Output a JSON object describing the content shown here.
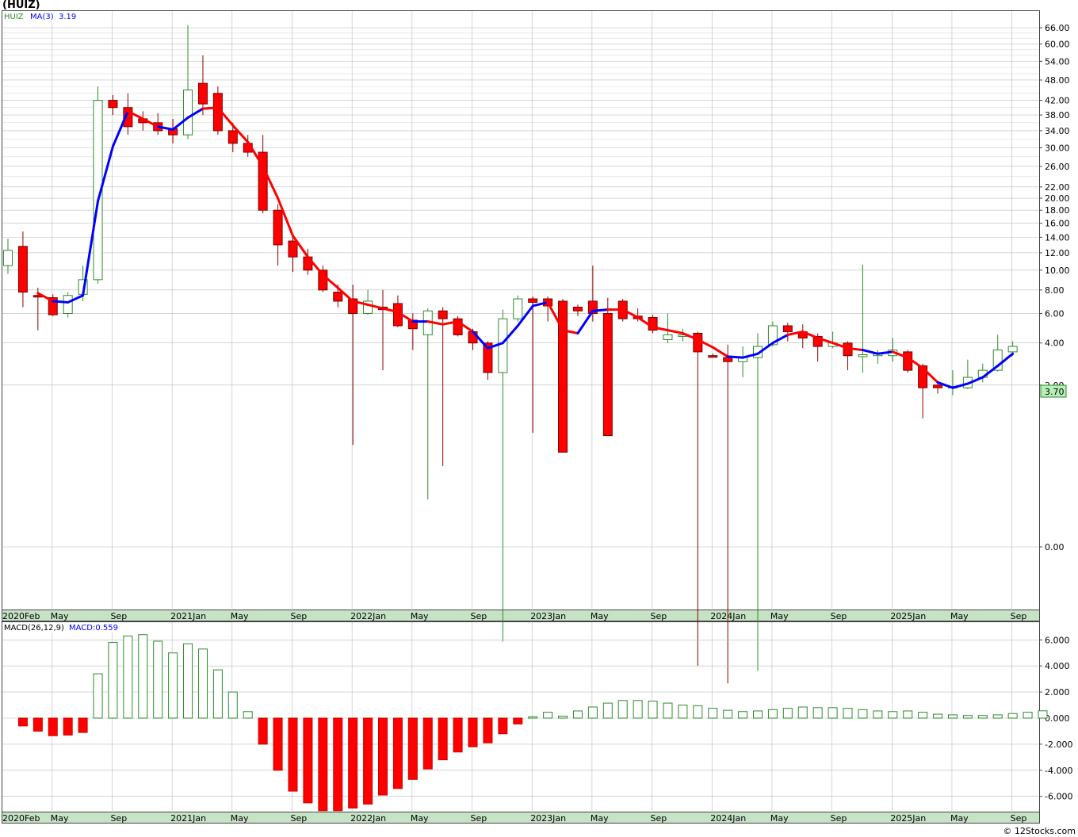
{
  "title": "(HUIZ)",
  "watermark": "© 12Stocks.com",
  "colors": {
    "up_candle": "#2e8b2e",
    "down_candle": "#ff0000",
    "ma_up": "#0000ff",
    "ma_down": "#ff0000",
    "grid": "#bbbbbb",
    "price_badge": "#b6f0b6"
  },
  "chart_data": [
    {
      "type": "candlestick",
      "title": "",
      "legend": {
        "symbol": "HUIZ",
        "ma_label": "MA(3)",
        "ma_value": "3.19"
      },
      "ylim": [
        -1.2,
        70
      ],
      "grid": true,
      "y_ticks": [
        "66.00",
        "60.00",
        "54.00",
        "48.00",
        "42.00",
        "38.00",
        "34.00",
        "30.00",
        "26.00",
        "22.00",
        "20.00",
        "18.00",
        "16.00",
        "14.00",
        "12.00",
        "10.00",
        "8.00",
        "6.00",
        "4.00",
        "2.00",
        "0.00"
      ],
      "x_tick_labels": [
        "2020Feb",
        "May",
        "Sep",
        "2021Jan",
        "May",
        "Sep",
        "2022Jan",
        "May",
        "Sep",
        "2023Jan",
        "May",
        "Sep",
        "2024Jan",
        "May",
        "Sep",
        "2025Jan",
        "May",
        "Sep"
      ],
      "last_price_label": "3.70",
      "candles": [
        {
          "o": 10.5,
          "h": 13.8,
          "l": 9.6,
          "c": 12.3
        },
        {
          "o": 12.8,
          "h": 14.8,
          "l": 6.5,
          "c": 7.8
        },
        {
          "o": 7.5,
          "h": 8.2,
          "l": 4.8,
          "c": 7.4
        },
        {
          "o": 7.3,
          "h": 7.6,
          "l": 5.8,
          "c": 5.9
        },
        {
          "o": 6.0,
          "h": 7.8,
          "l": 5.7,
          "c": 7.5
        },
        {
          "o": 7.6,
          "h": 10.5,
          "l": 7.0,
          "c": 9.0
        },
        {
          "o": 9.0,
          "h": 46.0,
          "l": 8.6,
          "c": 42.0
        },
        {
          "o": 42.0,
          "h": 43.5,
          "l": 38.0,
          "c": 40.0
        },
        {
          "o": 40.0,
          "h": 44.0,
          "l": 33.0,
          "c": 35.0
        },
        {
          "o": 37.0,
          "h": 39.0,
          "l": 34.0,
          "c": 36.0
        },
        {
          "o": 36.0,
          "h": 38.5,
          "l": 33.0,
          "c": 34.0
        },
        {
          "o": 34.5,
          "h": 37.0,
          "l": 31.0,
          "c": 33.0
        },
        {
          "o": 33.0,
          "h": 67.0,
          "l": 32.0,
          "c": 45.0
        },
        {
          "o": 47.0,
          "h": 56.0,
          "l": 38.0,
          "c": 41.0
        },
        {
          "o": 44.0,
          "h": 46.0,
          "l": 33.0,
          "c": 34.0
        },
        {
          "o": 34.0,
          "h": 36.0,
          "l": 29.0,
          "c": 31.0
        },
        {
          "o": 31.0,
          "h": 33.0,
          "l": 28.0,
          "c": 29.0
        },
        {
          "o": 29.0,
          "h": 33.0,
          "l": 17.5,
          "c": 18.0
        },
        {
          "o": 18.0,
          "h": 19.0,
          "l": 10.5,
          "c": 13.0
        },
        {
          "o": 13.5,
          "h": 14.5,
          "l": 9.8,
          "c": 11.5
        },
        {
          "o": 11.5,
          "h": 12.5,
          "l": 9.5,
          "c": 10.0
        },
        {
          "o": 10.0,
          "h": 10.5,
          "l": 7.8,
          "c": 8.0
        },
        {
          "o": 7.8,
          "h": 8.5,
          "l": 6.5,
          "c": 7.0
        },
        {
          "o": 7.2,
          "h": 8.5,
          "l": 0.5,
          "c": 6.0
        },
        {
          "o": 6.0,
          "h": 8.0,
          "l": 5.9,
          "c": 7.0
        },
        {
          "o": 6.5,
          "h": 8.0,
          "l": 2.6,
          "c": 6.3
        },
        {
          "o": 6.8,
          "h": 7.5,
          "l": 5.0,
          "c": 5.1
        },
        {
          "o": 5.5,
          "h": 6.0,
          "l": 3.6,
          "c": 4.9
        },
        {
          "o": 4.5,
          "h": 6.4,
          "l": 0.05,
          "c": 6.2
        },
        {
          "o": 6.2,
          "h": 6.5,
          "l": 0.25,
          "c": 5.6
        },
        {
          "o": 5.6,
          "h": 5.8,
          "l": 4.4,
          "c": 4.5
        },
        {
          "o": 4.7,
          "h": 4.9,
          "l": 3.6,
          "c": 4.0
        },
        {
          "o": 4.0,
          "h": 4.1,
          "l": 2.2,
          "c": 2.5
        },
        {
          "o": 2.5,
          "h": 6.3,
          "l": -0.4,
          "c": 5.6
        },
        {
          "o": 5.6,
          "h": 7.5,
          "l": 5.4,
          "c": 7.2
        },
        {
          "o": 7.2,
          "h": 7.4,
          "l": 0.7,
          "c": 6.9
        },
        {
          "o": 7.2,
          "h": 7.4,
          "l": 5.4,
          "c": 6.6
        },
        {
          "o": 7.0,
          "h": 7.2,
          "l": 0.4,
          "c": 0.4
        },
        {
          "o": 6.5,
          "h": 6.7,
          "l": 5.8,
          "c": 6.2
        },
        {
          "o": 7.0,
          "h": 10.5,
          "l": 5.4,
          "c": 6.0
        },
        {
          "o": 6.0,
          "h": 7.3,
          "l": 0.65,
          "c": 0.65
        },
        {
          "o": 7.0,
          "h": 7.2,
          "l": 5.4,
          "c": 5.6
        },
        {
          "o": 5.8,
          "h": 6.4,
          "l": 5.4,
          "c": 5.6
        },
        {
          "o": 5.7,
          "h": 5.9,
          "l": 4.6,
          "c": 4.8
        },
        {
          "o": 4.2,
          "h": 6.0,
          "l": 4.0,
          "c": 4.5
        },
        {
          "o": 4.5,
          "h": 4.9,
          "l": 4.1,
          "c": 4.5
        },
        {
          "o": 4.6,
          "h": 4.7,
          "l": -0.8,
          "c": 3.5
        },
        {
          "o": 3.3,
          "h": 3.4,
          "l": 3.2,
          "c": 3.25
        },
        {
          "o": 3.2,
          "h": 3.9,
          "l": -1.2,
          "c": 3.0
        },
        {
          "o": 3.0,
          "h": 3.8,
          "l": 2.3,
          "c": 3.2
        },
        {
          "o": 3.2,
          "h": 4.6,
          "l": -0.9,
          "c": 3.8
        },
        {
          "o": 3.9,
          "h": 5.4,
          "l": 3.8,
          "c": 5.1
        },
        {
          "o": 5.1,
          "h": 5.3,
          "l": 4.1,
          "c": 4.7
        },
        {
          "o": 4.7,
          "h": 5.2,
          "l": 3.7,
          "c": 4.3
        },
        {
          "o": 4.4,
          "h": 4.6,
          "l": 3.0,
          "c": 3.8
        },
        {
          "o": 3.8,
          "h": 4.7,
          "l": 3.7,
          "c": 4.0
        },
        {
          "o": 4.0,
          "h": 4.1,
          "l": 2.6,
          "c": 3.3
        },
        {
          "o": 3.25,
          "h": 10.6,
          "l": 2.5,
          "c": 3.35
        },
        {
          "o": 3.3,
          "h": 3.6,
          "l": 2.9,
          "c": 3.4
        },
        {
          "o": 3.3,
          "h": 4.3,
          "l": 3.0,
          "c": 3.6
        },
        {
          "o": 3.5,
          "h": 3.6,
          "l": 2.5,
          "c": 2.6
        },
        {
          "o": 2.8,
          "h": 2.9,
          "l": 1.0,
          "c": 1.9
        },
        {
          "o": 2.0,
          "h": 2.1,
          "l": 1.7,
          "c": 1.9
        },
        {
          "o": 1.9,
          "h": 2.6,
          "l": 1.65,
          "c": 1.95
        },
        {
          "o": 1.9,
          "h": 3.1,
          "l": 1.85,
          "c": 2.3
        },
        {
          "o": 2.3,
          "h": 2.9,
          "l": 2.1,
          "c": 2.6
        },
        {
          "o": 2.6,
          "h": 4.5,
          "l": 2.55,
          "c": 3.6
        },
        {
          "o": 3.5,
          "h": 4.1,
          "l": 3.3,
          "c": 3.8
        }
      ],
      "ma3": [
        null,
        null,
        7.7,
        7.0,
        6.9,
        7.5,
        19.5,
        30.3,
        39.0,
        37.0,
        35.0,
        34.3,
        37.3,
        39.7,
        40.0,
        35.3,
        31.3,
        26.0,
        20.0,
        14.2,
        11.5,
        9.5,
        8.2,
        7.0,
        6.7,
        6.4,
        6.1,
        5.4,
        5.4,
        5.2,
        5.4,
        4.7,
        3.7,
        4.0,
        5.1,
        6.6,
        6.9,
        4.8,
        4.6,
        6.2,
        6.3,
        6.3,
        5.7,
        5.0,
        4.8,
        4.6,
        4.2,
        3.75,
        3.25,
        3.2,
        3.4,
        4.0,
        4.5,
        4.7,
        4.3,
        4.0,
        3.7,
        3.6,
        3.4,
        3.5,
        3.2,
        2.7,
        2.1,
        1.9,
        2.05,
        2.3,
        2.8,
        3.4
      ],
      "ma_trend": [
        "d",
        "d",
        "d",
        "d",
        "u",
        "u",
        "u",
        "u",
        "u",
        "d",
        "d",
        "u",
        "u",
        "u",
        "d",
        "d",
        "d",
        "d",
        "d",
        "d",
        "d",
        "d",
        "d",
        "d",
        "d",
        "d",
        "d",
        "d",
        "u",
        "d",
        "d",
        "d",
        "u",
        "u",
        "u",
        "u",
        "u",
        "d",
        "d",
        "u",
        "u",
        "d",
        "d",
        "d",
        "d",
        "d",
        "d",
        "d",
        "d",
        "u",
        "u",
        "u",
        "u",
        "d",
        "d",
        "d",
        "d",
        "d",
        "u",
        "u",
        "d",
        "d",
        "d",
        "u",
        "u",
        "u",
        "u",
        "u"
      ]
    },
    {
      "type": "bar",
      "title": "",
      "legend": {
        "label": "MACD(26,12,9)",
        "value_label": "MACD:0.559"
      },
      "ylim": [
        -7.2,
        7.0
      ],
      "grid": true,
      "y_ticks": [
        "6.000",
        "4.000",
        "2.000",
        "0.000",
        "-2.000",
        "-4.000",
        "-6.000"
      ],
      "x_tick_labels": [
        "2020Feb",
        "May",
        "Sep",
        "2021Jan",
        "May",
        "Sep",
        "2022Jan",
        "May",
        "Sep",
        "2023Jan",
        "May",
        "Sep",
        "2024Jan",
        "May",
        "Sep",
        "2025Jan",
        "May",
        "Sep"
      ],
      "values": [
        null,
        -0.6,
        -1.0,
        -1.35,
        -1.3,
        -1.1,
        3.4,
        5.8,
        6.3,
        6.4,
        5.9,
        5.0,
        5.7,
        5.3,
        3.7,
        2.0,
        0.5,
        -2.0,
        -4.0,
        -5.6,
        -6.5,
        -7.1,
        -7.1,
        -6.9,
        -6.6,
        -5.9,
        -5.4,
        -4.7,
        -3.9,
        -3.2,
        -2.6,
        -2.2,
        -1.9,
        -1.2,
        -0.45,
        0.1,
        0.45,
        0.15,
        0.55,
        0.85,
        1.15,
        1.35,
        1.35,
        1.3,
        1.15,
        1.0,
        0.95,
        0.75,
        0.6,
        0.5,
        0.55,
        0.65,
        0.75,
        0.85,
        0.8,
        0.8,
        0.75,
        0.65,
        0.55,
        0.5,
        0.55,
        0.45,
        0.3,
        0.25,
        0.2,
        0.2,
        0.25,
        0.35,
        0.45,
        0.56
      ]
    }
  ]
}
